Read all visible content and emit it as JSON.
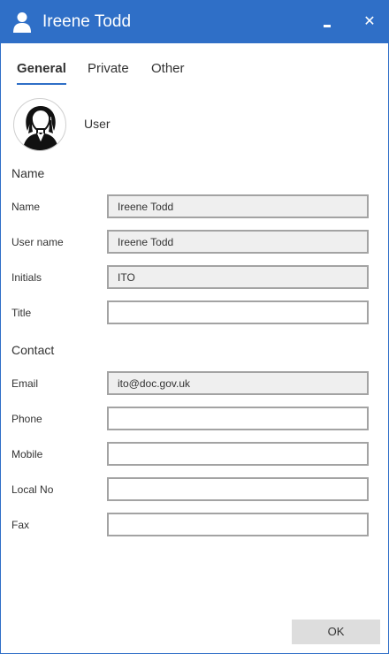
{
  "window": {
    "title": "Ireene Todd",
    "title_icon": "user-icon",
    "minimize_icon": "minimize-icon",
    "close_glyph": "✕",
    "accent_color": "#2f6fc7"
  },
  "tabs": [
    {
      "label": "General",
      "active": true
    },
    {
      "label": "Private",
      "active": false
    },
    {
      "label": "Other",
      "active": false
    }
  ],
  "profile": {
    "avatar_icon": "person-avatar-icon",
    "role": "User"
  },
  "sections": {
    "name": "Name",
    "contact": "Contact"
  },
  "fields": {
    "name": {
      "label": "Name",
      "value": "Ireene Todd"
    },
    "user_name": {
      "label": "User name",
      "value": "Ireene Todd"
    },
    "initials": {
      "label": "Initials",
      "value": "ITO"
    },
    "title": {
      "label": "Title",
      "value": ""
    },
    "email": {
      "label": "Email",
      "value": "ito@doc.gov.uk"
    },
    "phone": {
      "label": "Phone",
      "value": ""
    },
    "mobile": {
      "label": "Mobile",
      "value": ""
    },
    "local_no": {
      "label": "Local No",
      "value": ""
    },
    "fax": {
      "label": "Fax",
      "value": ""
    }
  },
  "buttons": {
    "ok": "OK"
  }
}
